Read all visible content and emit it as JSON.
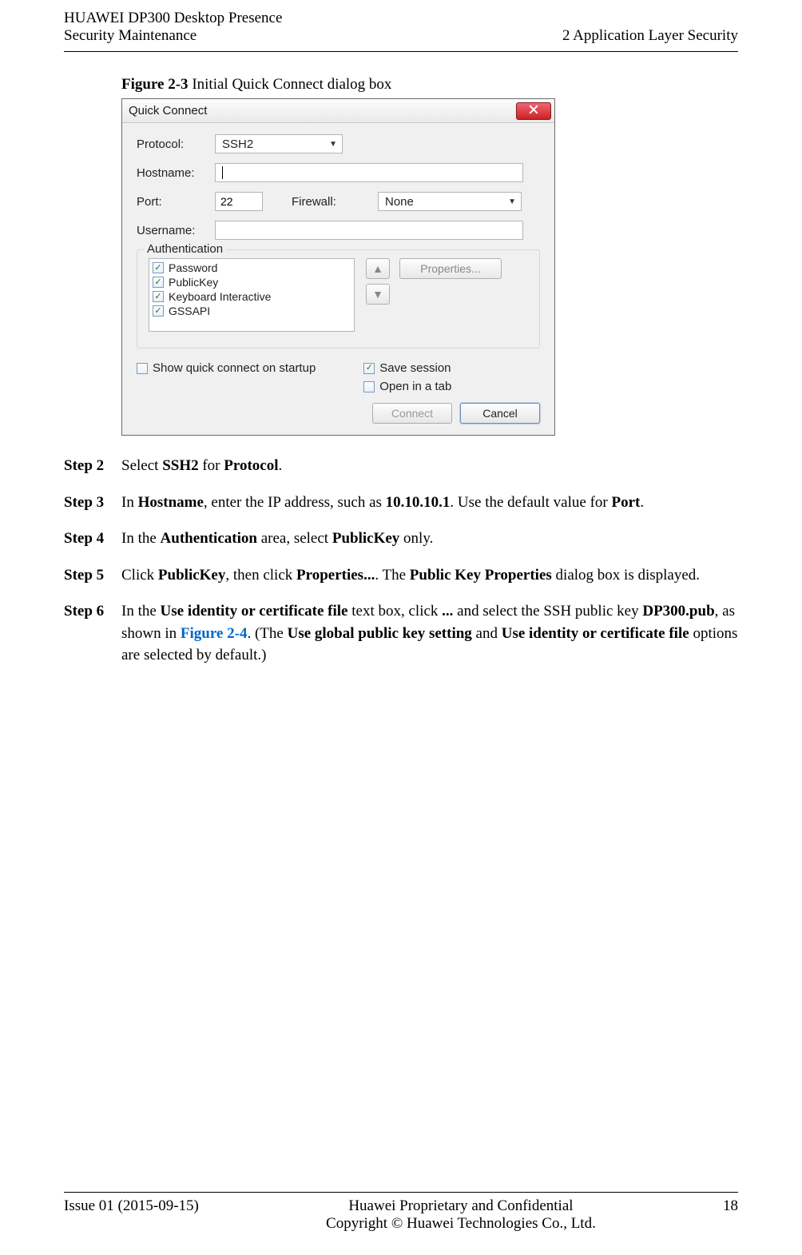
{
  "header": {
    "left_line1": "HUAWEI DP300 Desktop Presence",
    "left_line2": "Security Maintenance",
    "right": "2 Application Layer Security"
  },
  "figure": {
    "label": "Figure 2-3",
    "caption": " Initial Quick Connect dialog box"
  },
  "dialog": {
    "title": "Quick Connect",
    "labels": {
      "protocol": "Protocol:",
      "hostname": "Hostname:",
      "port": "Port:",
      "firewall": "Firewall:",
      "username": "Username:"
    },
    "values": {
      "protocol": "SSH2",
      "hostname": "",
      "port": "22",
      "firewall": "None",
      "username": ""
    },
    "auth": {
      "group_title": "Authentication",
      "items": [
        "Password",
        "PublicKey",
        "Keyboard Interactive",
        "GSSAPI"
      ],
      "properties_btn": "Properties..."
    },
    "options": {
      "show_startup": "Show quick connect on startup",
      "save_session": "Save session",
      "open_tab": "Open in a tab"
    },
    "footer": {
      "connect": "Connect",
      "cancel": "Cancel"
    }
  },
  "steps": {
    "s2": {
      "label": "Step 2",
      "t1": "Select ",
      "b1": "SSH2",
      "t2": " for ",
      "b2": "Protocol",
      "t3": "."
    },
    "s3": {
      "label": "Step 3",
      "t1": "In ",
      "b1": "Hostname",
      "t2": ", enter the IP address, such as ",
      "b2": "10.10.10.1",
      "t3": ". Use the default value for ",
      "b3": "Port",
      "t4": "."
    },
    "s4": {
      "label": "Step 4",
      "t1": "In the ",
      "b1": "Authentication",
      "t2": " area, select ",
      "b2": "PublicKey",
      "t3": " only."
    },
    "s5": {
      "label": "Step 5",
      "t1": "Click ",
      "b1": "PublicKey",
      "t2": ", then click ",
      "b2": "Properties...",
      "t3": ". The ",
      "b3": "Public Key Properties",
      "t4": " dialog box is displayed."
    },
    "s6": {
      "label": "Step 6",
      "t1": "In the ",
      "b1": "Use identity or certificate file",
      "t2": " text box, click ",
      "b2": "...",
      "t3": " and select the SSH public key ",
      "b3": "DP300.pub",
      "t4": ", as shown in ",
      "link": "Figure 2-4",
      "t5": ". (The ",
      "b4": "Use global public key setting",
      "t6": " and ",
      "b5": "Use identity or certificate file",
      "t7": " options are selected by default.)"
    }
  },
  "footer": {
    "issue": "Issue 01 (2015-09-15)",
    "center1": "Huawei Proprietary and Confidential",
    "center2": "Copyright © Huawei Technologies Co., Ltd.",
    "page": "18"
  }
}
